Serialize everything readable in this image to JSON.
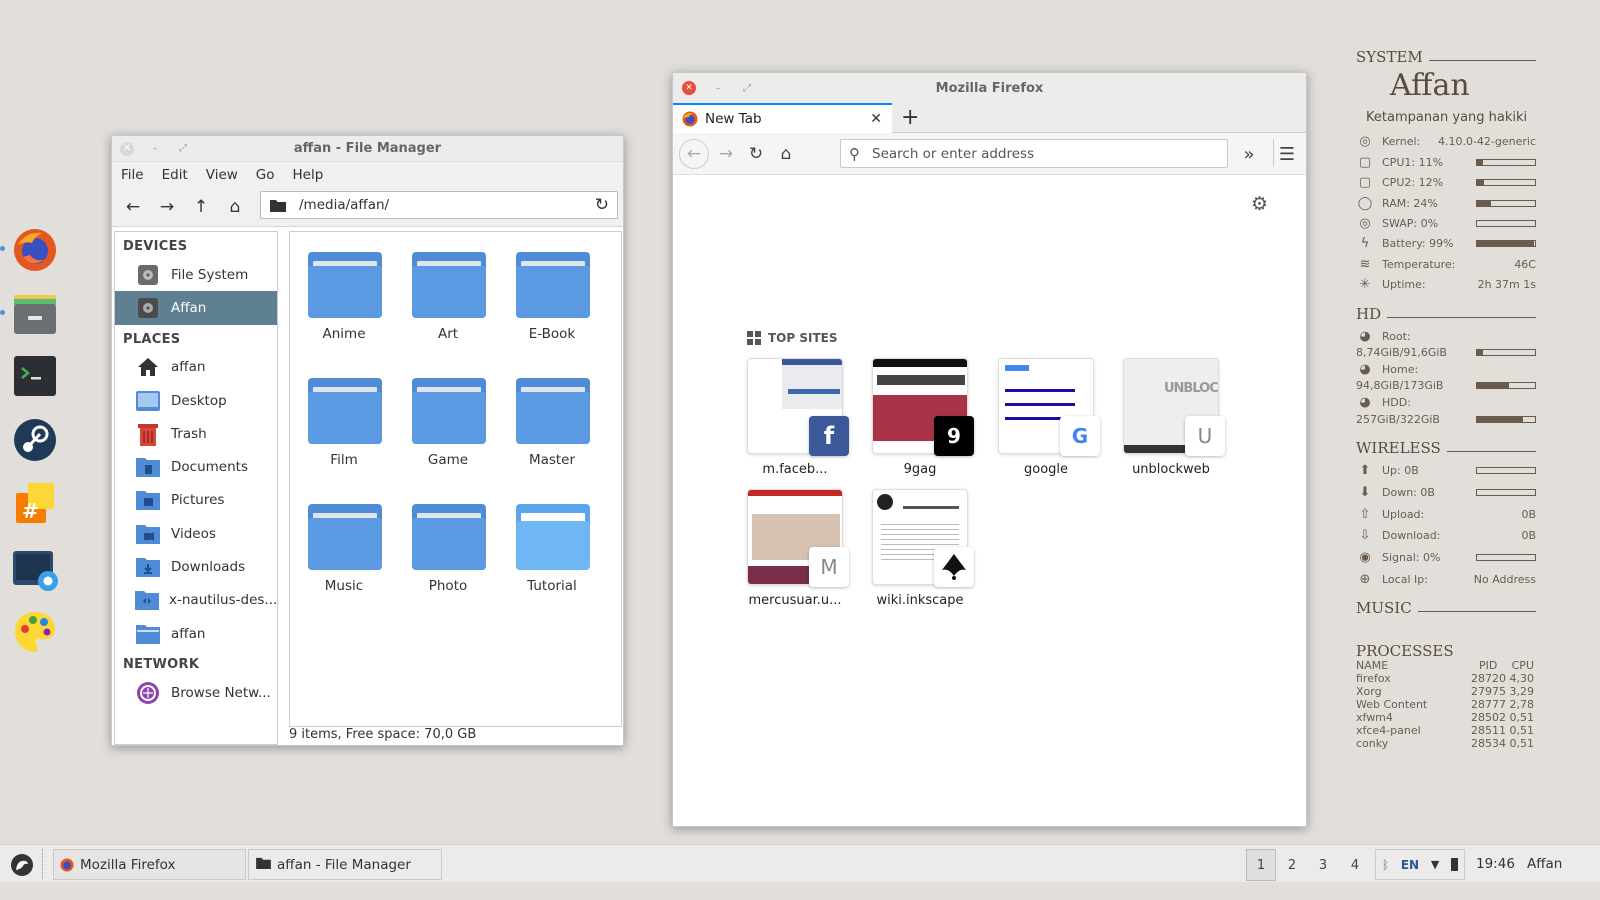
{
  "file_manager": {
    "title": "affan - File Manager",
    "menu": [
      "File",
      "Edit",
      "View",
      "Go",
      "Help"
    ],
    "path": "/media/affan/",
    "sidebar": {
      "devices_header": "DEVICES",
      "devices": [
        {
          "label": "File System",
          "icon": "drive-icon"
        },
        {
          "label": "Affan",
          "icon": "drive-icon"
        }
      ],
      "places_header": "PLACES",
      "places": [
        {
          "label": "affan",
          "icon": "home-icon"
        },
        {
          "label": "Desktop",
          "icon": "desktop-icon"
        },
        {
          "label": "Trash",
          "icon": "trash-icon"
        },
        {
          "label": "Documents",
          "icon": "documents-folder-icon"
        },
        {
          "label": "Pictures",
          "icon": "pictures-folder-icon"
        },
        {
          "label": "Videos",
          "icon": "videos-folder-icon"
        },
        {
          "label": "Downloads",
          "icon": "downloads-folder-icon"
        },
        {
          "label": "x-nautilus-des...",
          "icon": "folder-icon"
        },
        {
          "label": "affan",
          "icon": "folder-icon"
        }
      ],
      "network_header": "NETWORK",
      "network": [
        {
          "label": "Browse Netw...",
          "icon": "network-icon"
        }
      ]
    },
    "folders": [
      "Anime",
      "Art",
      "E-Book",
      "Film",
      "Game",
      "Master",
      "Music",
      "Photo",
      "Tutorial"
    ],
    "status": "9 items, Free space: 70,0 GB"
  },
  "firefox": {
    "title": "Mozilla Firefox",
    "tab_label": "New Tab",
    "address_placeholder": "Search or enter address",
    "top_sites_label": "TOP SITES",
    "tiles": [
      {
        "label": "m.faceb...",
        "badge": "f"
      },
      {
        "label": "9gag",
        "badge": "9"
      },
      {
        "label": "google",
        "badge": "G"
      },
      {
        "label": "unblockweb",
        "badge": "U"
      },
      {
        "label": "mercusuar.u...",
        "badge": "M"
      },
      {
        "label": "wiki.inkscape",
        "badge": "ink"
      }
    ]
  },
  "conky": {
    "system_header": "SYSTEM",
    "user": "Affan",
    "tagline": "Ketampanan yang hakiki",
    "kernel_label": "Kernel:",
    "kernel_value": "4.10.0-42-generic",
    "cpu1": "CPU1: 11%",
    "cpu1_level": 0.11,
    "cpu2": "CPU2: 12%",
    "cpu2_level": 0.12,
    "ram": "RAM: 24%",
    "ram_level": 0.24,
    "swap": "SWAP: 0%",
    "swap_level": 0.0,
    "battery": "Battery: 99%",
    "battery_level": 0.99,
    "temperature_label": "Temperature:",
    "temperature_value": "46C",
    "uptime_label": "Uptime:",
    "uptime_value": "2h 37m 1s",
    "hd_header": "HD",
    "root_label": "Root:",
    "root_value": "8,74GiB/91,6GiB",
    "root_level": 0.1,
    "home_label": "Home:",
    "home_value": "94,8GiB/173GiB",
    "home_level": 0.55,
    "hdd_label": "HDD:",
    "hdd_value": "257GiB/322GiB",
    "hdd_level": 0.8,
    "wireless_header": "WIRELESS",
    "up": "Up: 0B",
    "down": "Down: 0B",
    "upload_label": "Upload:",
    "upload_value": "0B",
    "download_label": "Download:",
    "download_value": "0B",
    "signal": "Signal: 0%",
    "localip_label": "Local Ip:",
    "localip_value": "No Address",
    "music_header": "MUSIC",
    "processes_header": "PROCESSES",
    "proc_cols": [
      "NAME",
      "PID",
      "CPU"
    ],
    "processes": [
      {
        "name": "firefox",
        "pid": "28720",
        "cpu": "4,30"
      },
      {
        "name": "Xorg",
        "pid": "27975",
        "cpu": "3,29"
      },
      {
        "name": "Web Content",
        "pid": "28777",
        "cpu": "2,78"
      },
      {
        "name": "xfwm4",
        "pid": "28502",
        "cpu": "0,51"
      },
      {
        "name": "xfce4-panel",
        "pid": "28511",
        "cpu": "0,51"
      },
      {
        "name": "conky",
        "pid": "28534",
        "cpu": "0,51"
      }
    ]
  },
  "taskbar": {
    "tasks": [
      "Mozilla Firefox",
      "affan - File Manager"
    ],
    "workspaces": [
      "1",
      "2",
      "3",
      "4"
    ],
    "lang": "EN",
    "clock": "19:46",
    "user": "Affan"
  }
}
